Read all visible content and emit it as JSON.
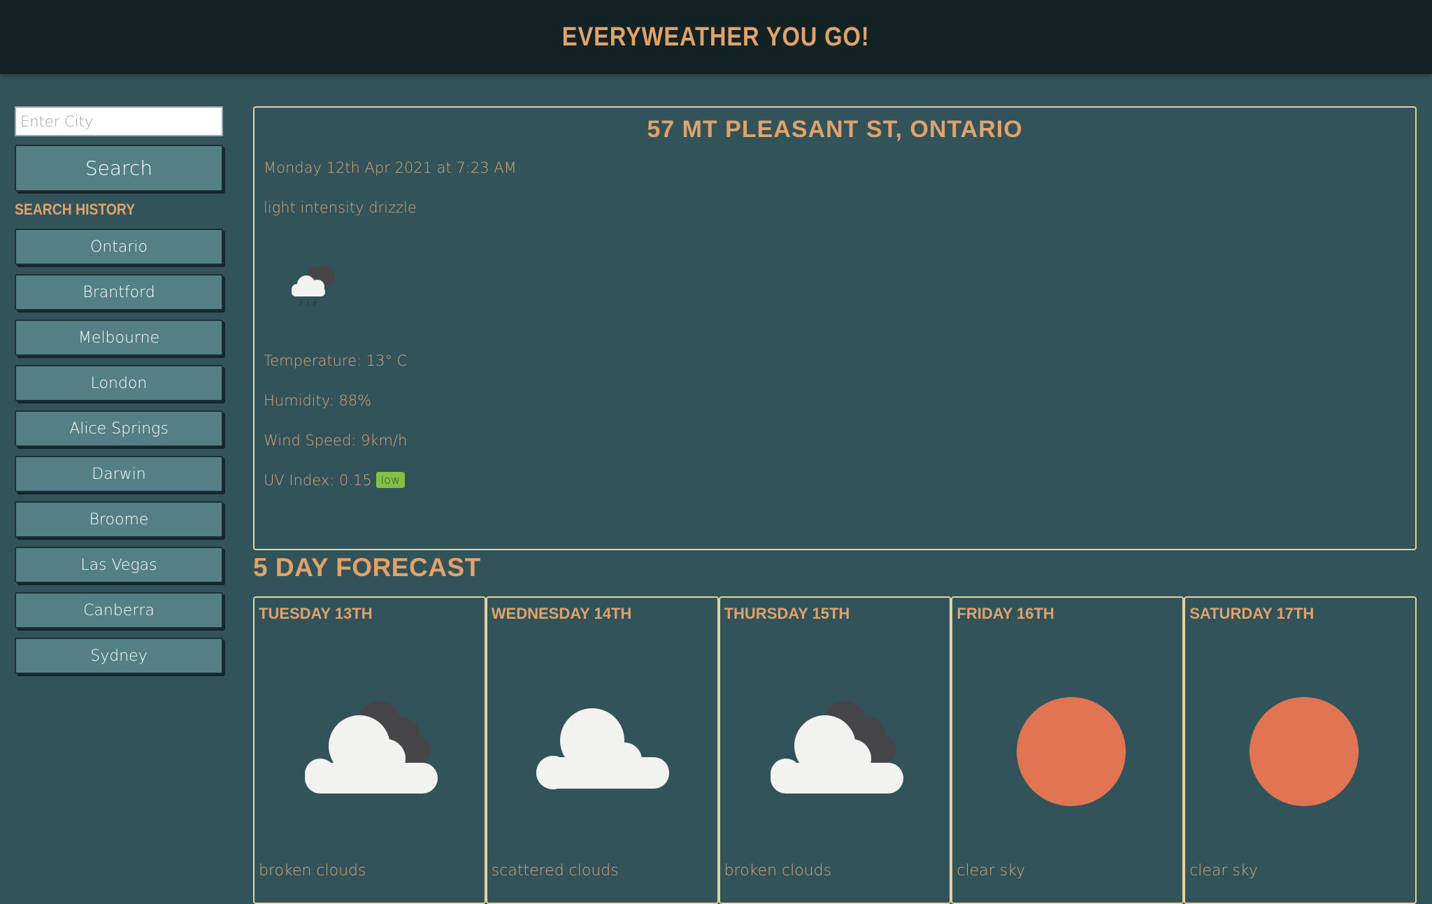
{
  "header": {
    "title": "EVERYWEATHER YOU GO!"
  },
  "sidebar": {
    "search_placeholder": "Enter City",
    "search_label": "Search",
    "history_title": "SEARCH HISTORY",
    "history": [
      "Ontario",
      "Brantford",
      "Melbourne",
      "London",
      "Alice Springs",
      "Darwin",
      "Broome",
      "Las Vegas",
      "Canberra",
      "Sydney"
    ]
  },
  "current": {
    "city": "57 MT PLEASANT ST, ONTARIO",
    "datetime": "Monday 12th Apr 2021 at 7:23 AM",
    "description": "light intensity drizzle",
    "icon": "cloud-drizzle-icon",
    "temperature": "Temperature: 13° C",
    "humidity": "Humidity: 88%",
    "wind": "Wind Speed: 9km/h",
    "uv_label": "UV Index: 0.15",
    "uv_badge": "low",
    "uv_badge_color": "#83c044"
  },
  "forecast": {
    "title": "5 DAY FORECAST",
    "days": [
      {
        "day": "TUESDAY 13TH",
        "icon": "broken-clouds-icon",
        "desc": "broken clouds"
      },
      {
        "day": "WEDNESDAY 14TH",
        "icon": "scattered-clouds-icon",
        "desc": "scattered clouds"
      },
      {
        "day": "THURSDAY 15TH",
        "icon": "broken-clouds-icon",
        "desc": "broken clouds"
      },
      {
        "day": "FRIDAY 16TH",
        "icon": "clear-sky-icon",
        "desc": "clear sky"
      },
      {
        "day": "SATURDAY 17TH",
        "icon": "clear-sky-icon",
        "desc": "clear sky"
      }
    ]
  },
  "colors": {
    "background": "#32535a",
    "header": "#132224",
    "accent": "#e2a36b",
    "button": "#547f86",
    "card_border": "#e5d29c",
    "sun": "#e07453"
  }
}
